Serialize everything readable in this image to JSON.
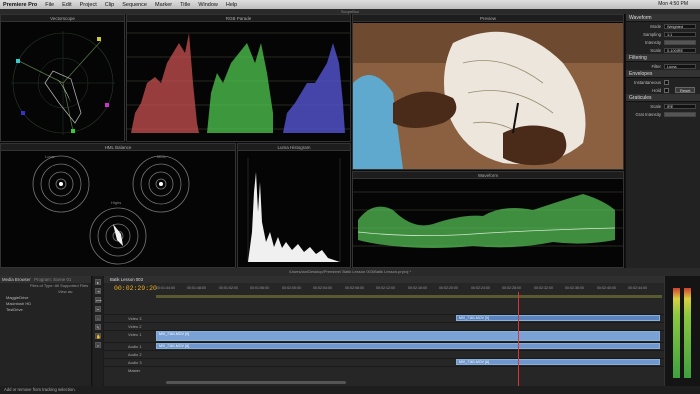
{
  "menubar": {
    "app": "Premiere Pro",
    "items": [
      "File",
      "Edit",
      "Project",
      "Clip",
      "Sequence",
      "Marker",
      "Title",
      "Window",
      "Help"
    ],
    "status": "Mon 4:50 PM"
  },
  "window_title": "ScopeBox",
  "panels": {
    "vectorscope": "Vectorscope",
    "rgb_parade": "RGB Parade",
    "preview": "Preview",
    "hml_balance": "HML Balance",
    "luma_histogram": "Luma Histogram",
    "waveform": "Waveform",
    "hml_labels": {
      "lows": "Lows",
      "mids": "Mids",
      "highs": "Highs"
    }
  },
  "controls": {
    "waveform_header": "Waveform",
    "mode_label": "Mode",
    "mode_value": "Weighted",
    "sampling_label": "Sampling",
    "sampling_value": "1:1",
    "intensity_label": "Intensity",
    "scale_label": "Scale",
    "scale_value": "0-100IRE",
    "filtering_header": "Filtering",
    "filter_label": "Filter",
    "filter_value": "Luma",
    "envelopes_header": "Envelopes",
    "instantaneous_label": "Instantaneous",
    "hold_label": "Hold",
    "reset_label": "Reset",
    "graticules_header": "Graticules",
    "graticule_scale_label": "Scale",
    "graticule_scale_value": "IRE",
    "grat_intensity_label": "Grat Intensity"
  },
  "media_browser": {
    "tab": "Media Browser",
    "tab2": "Program: Scene 01",
    "filter_label": "Files of Type:",
    "filter_value": "All Supported Files",
    "view_label": "View as:",
    "items": [
      "MaggieDrive",
      "Macintosh HD",
      "TestDrive"
    ]
  },
  "timeline": {
    "tab": "Batik Lesson 003",
    "timecode": "00:02:29:20",
    "path": "/Users/ian/Desktop/Premiere/ Batik Lesson 003/Batik Lesson.prproj *",
    "ruler": [
      "00:01:44:00",
      "00:01:48:00",
      "00:01:52:00",
      "00:01:56:00",
      "00:02:00:00",
      "00:02:04:00",
      "00:02:08:00",
      "00:02:12:00",
      "00:02:16:00",
      "00:02:20:00",
      "00:02:24:00",
      "00:02:28:00",
      "00:02:32:00",
      "00:02:36:00",
      "00:02:40:00",
      "00:02:44:00"
    ],
    "tracks": [
      "Video 3",
      "Video 2",
      "Video 1",
      "Audio 1",
      "Audio 2",
      "Audio 3",
      "Master"
    ],
    "clip_name": "MVI_7161.MOV [V]",
    "clip_name_a": "MVI_7161.MOV [A]"
  },
  "status_bar": "Add or remove from tracking selection."
}
